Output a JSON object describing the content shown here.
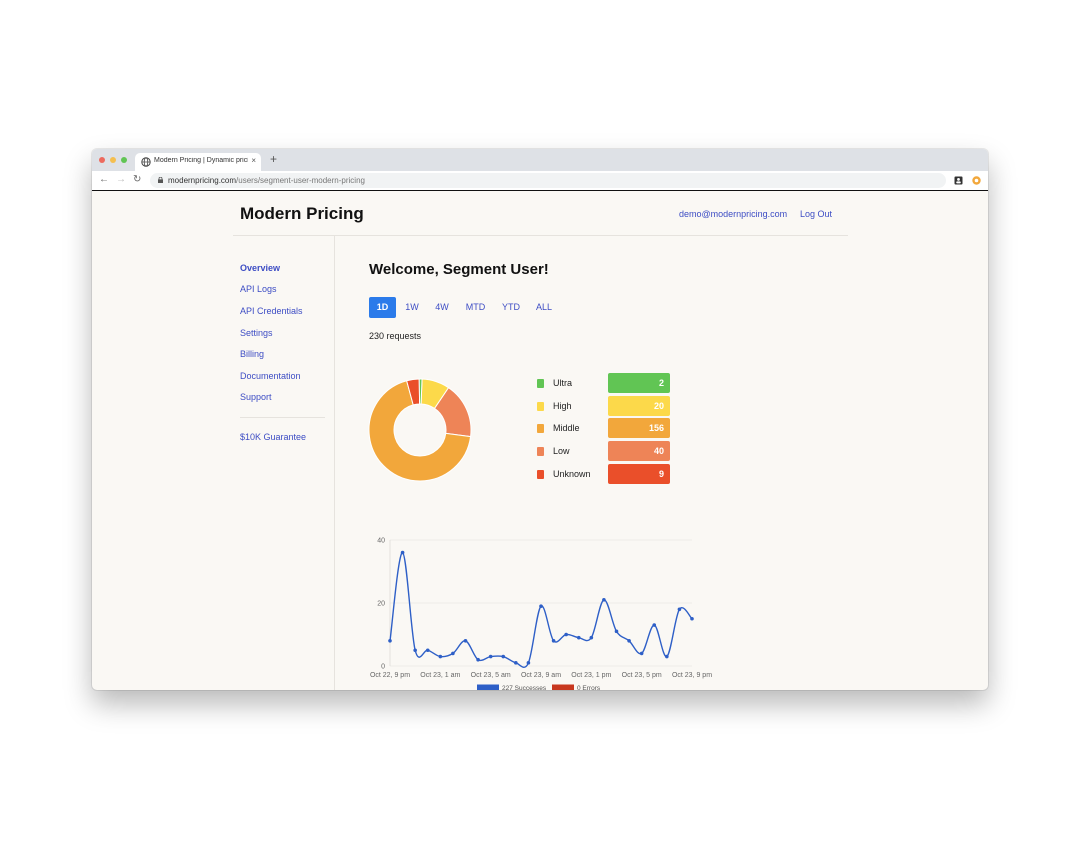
{
  "browser": {
    "tab_title": "Modern Pricing | Dynamic pricing",
    "tab_close": "×",
    "new_tab": "+",
    "back": "←",
    "forward": "→",
    "reload": "↻",
    "url_host": "modernpricing.com",
    "url_path": "/users/segment-user-modern-pricing"
  },
  "header": {
    "brand": "Modern Pricing",
    "email": "demo@modernpricing.com",
    "logout": "Log Out"
  },
  "sidebar": {
    "items": [
      {
        "label": "Overview",
        "active": true
      },
      {
        "label": "API Logs"
      },
      {
        "label": "API Credentials"
      },
      {
        "label": "Settings"
      },
      {
        "label": "Billing"
      },
      {
        "label": "Documentation"
      },
      {
        "label": "Support"
      }
    ],
    "guarantee": "$10K Guarantee"
  },
  "main": {
    "welcome": "Welcome, Segment User!",
    "ranges": [
      {
        "label": "1D",
        "active": true
      },
      {
        "label": "1W"
      },
      {
        "label": "4W"
      },
      {
        "label": "MTD"
      },
      {
        "label": "YTD"
      },
      {
        "label": "ALL"
      }
    ],
    "requests": "230 requests"
  },
  "colors": {
    "accent": "#2b7bea",
    "link": "#3d4dc4",
    "ultra": "#61c554",
    "high": "#fcd94a",
    "middle": "#f2a73b",
    "low": "#ee8457",
    "unknown": "#ea4f2a",
    "successes": "#2e5fc7",
    "errors": "#c8381f"
  },
  "chart_data": [
    {
      "type": "pie",
      "variant": "donut",
      "labels": [
        "Ultra",
        "High",
        "Middle",
        "Low",
        "Unknown"
      ],
      "values": [
        2,
        20,
        156,
        40,
        9
      ],
      "value_labels": [
        "2",
        "20",
        "156",
        "40",
        "9"
      ]
    },
    {
      "type": "line",
      "x_tick_labels": [
        "Oct 22, 9 pm",
        "Oct 23, 1 am",
        "Oct 23, 5 am",
        "Oct 23, 9 am",
        "Oct 23, 1 pm",
        "Oct 23, 5 pm",
        "Oct 23, 9 pm"
      ],
      "y_ticks": [
        "0",
        "20",
        "40"
      ],
      "ylim": [
        0,
        40
      ],
      "series": [
        {
          "name": "227 Successes",
          "values": [
            8,
            36,
            5,
            5,
            3,
            4,
            8,
            2,
            3,
            3,
            1,
            1,
            19,
            8,
            10,
            9,
            9,
            21,
            11,
            8,
            4,
            13,
            3,
            18,
            15
          ]
        },
        {
          "name": "0 Errors",
          "values": []
        }
      ],
      "grid": true,
      "legend": "bottom"
    }
  ]
}
